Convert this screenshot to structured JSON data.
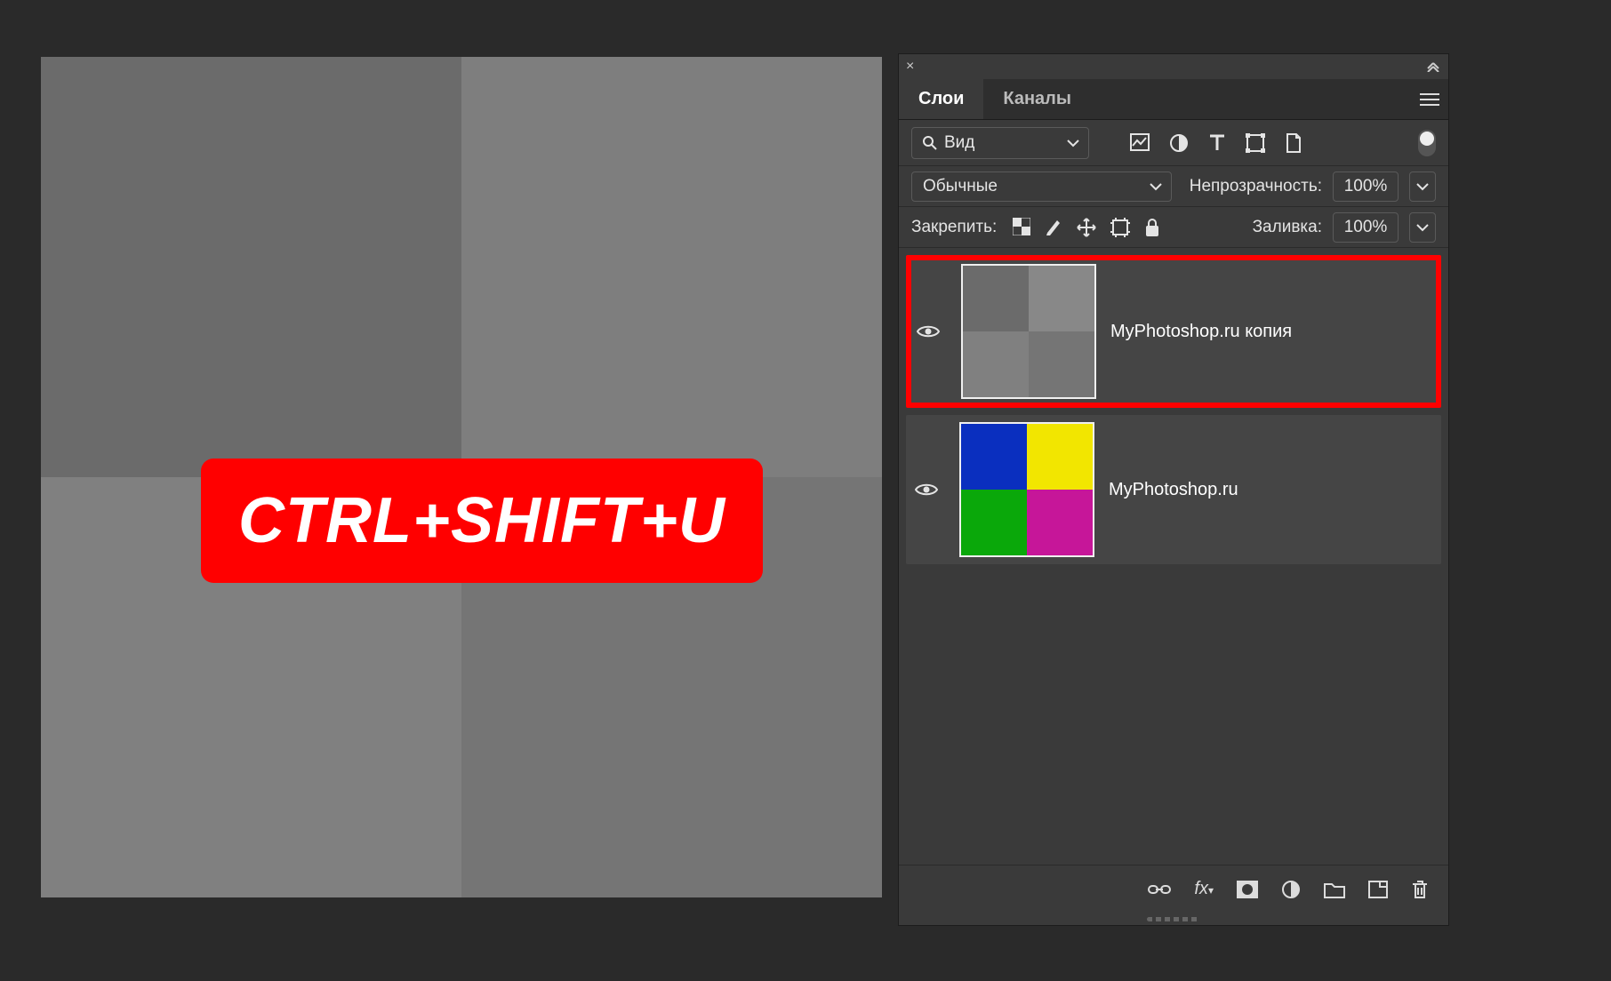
{
  "canvas": {
    "shortcut_text": "CTRL+SHIFT+U"
  },
  "panel": {
    "tabs": [
      {
        "label": "Слои",
        "active": true
      },
      {
        "label": "Каналы",
        "active": false
      }
    ],
    "filter": {
      "search_label": "Вид"
    },
    "blend": {
      "mode": "Обычные",
      "opacity_label": "Непрозрачность:",
      "opacity_value": "100%"
    },
    "lock": {
      "label": "Закрепить:",
      "fill_label": "Заливка:",
      "fill_value": "100%"
    },
    "layers": [
      {
        "name": "MyPhotoshop.ru копия",
        "selected": true,
        "thumb_variant": "grey"
      },
      {
        "name": "MyPhotoshop.ru",
        "selected": false,
        "thumb_variant": "color"
      }
    ]
  }
}
